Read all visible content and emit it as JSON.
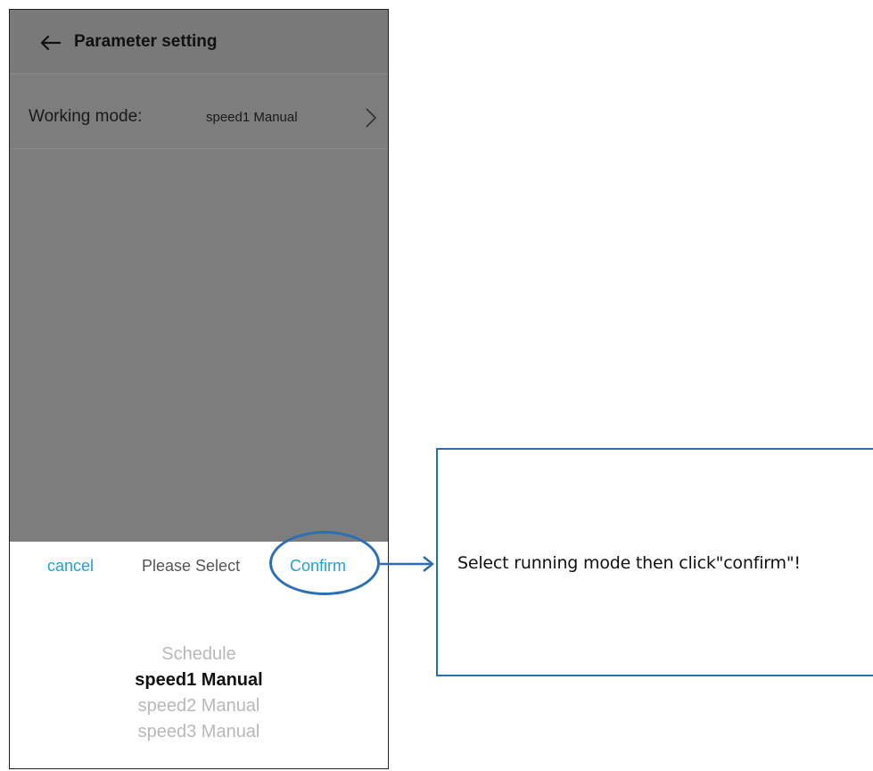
{
  "header": {
    "title": "Parameter setting"
  },
  "setting": {
    "label": "Working mode:",
    "value": "speed1 Manual"
  },
  "sheet": {
    "cancel_label": "cancel",
    "title": "Please Select",
    "confirm_label": "Confirm",
    "options": [
      {
        "label": "Schedule",
        "selected": false
      },
      {
        "label": "speed1 Manual",
        "selected": true
      },
      {
        "label": "speed2 Manual",
        "selected": false
      },
      {
        "label": "speed3 Manual",
        "selected": false
      }
    ]
  },
  "annotation": {
    "text": "Select running mode then click\"confirm\"!"
  },
  "colors": {
    "accent": "#1ea1d6",
    "annotation": "#2a6fb6",
    "overlay": "#7d7d7d"
  }
}
